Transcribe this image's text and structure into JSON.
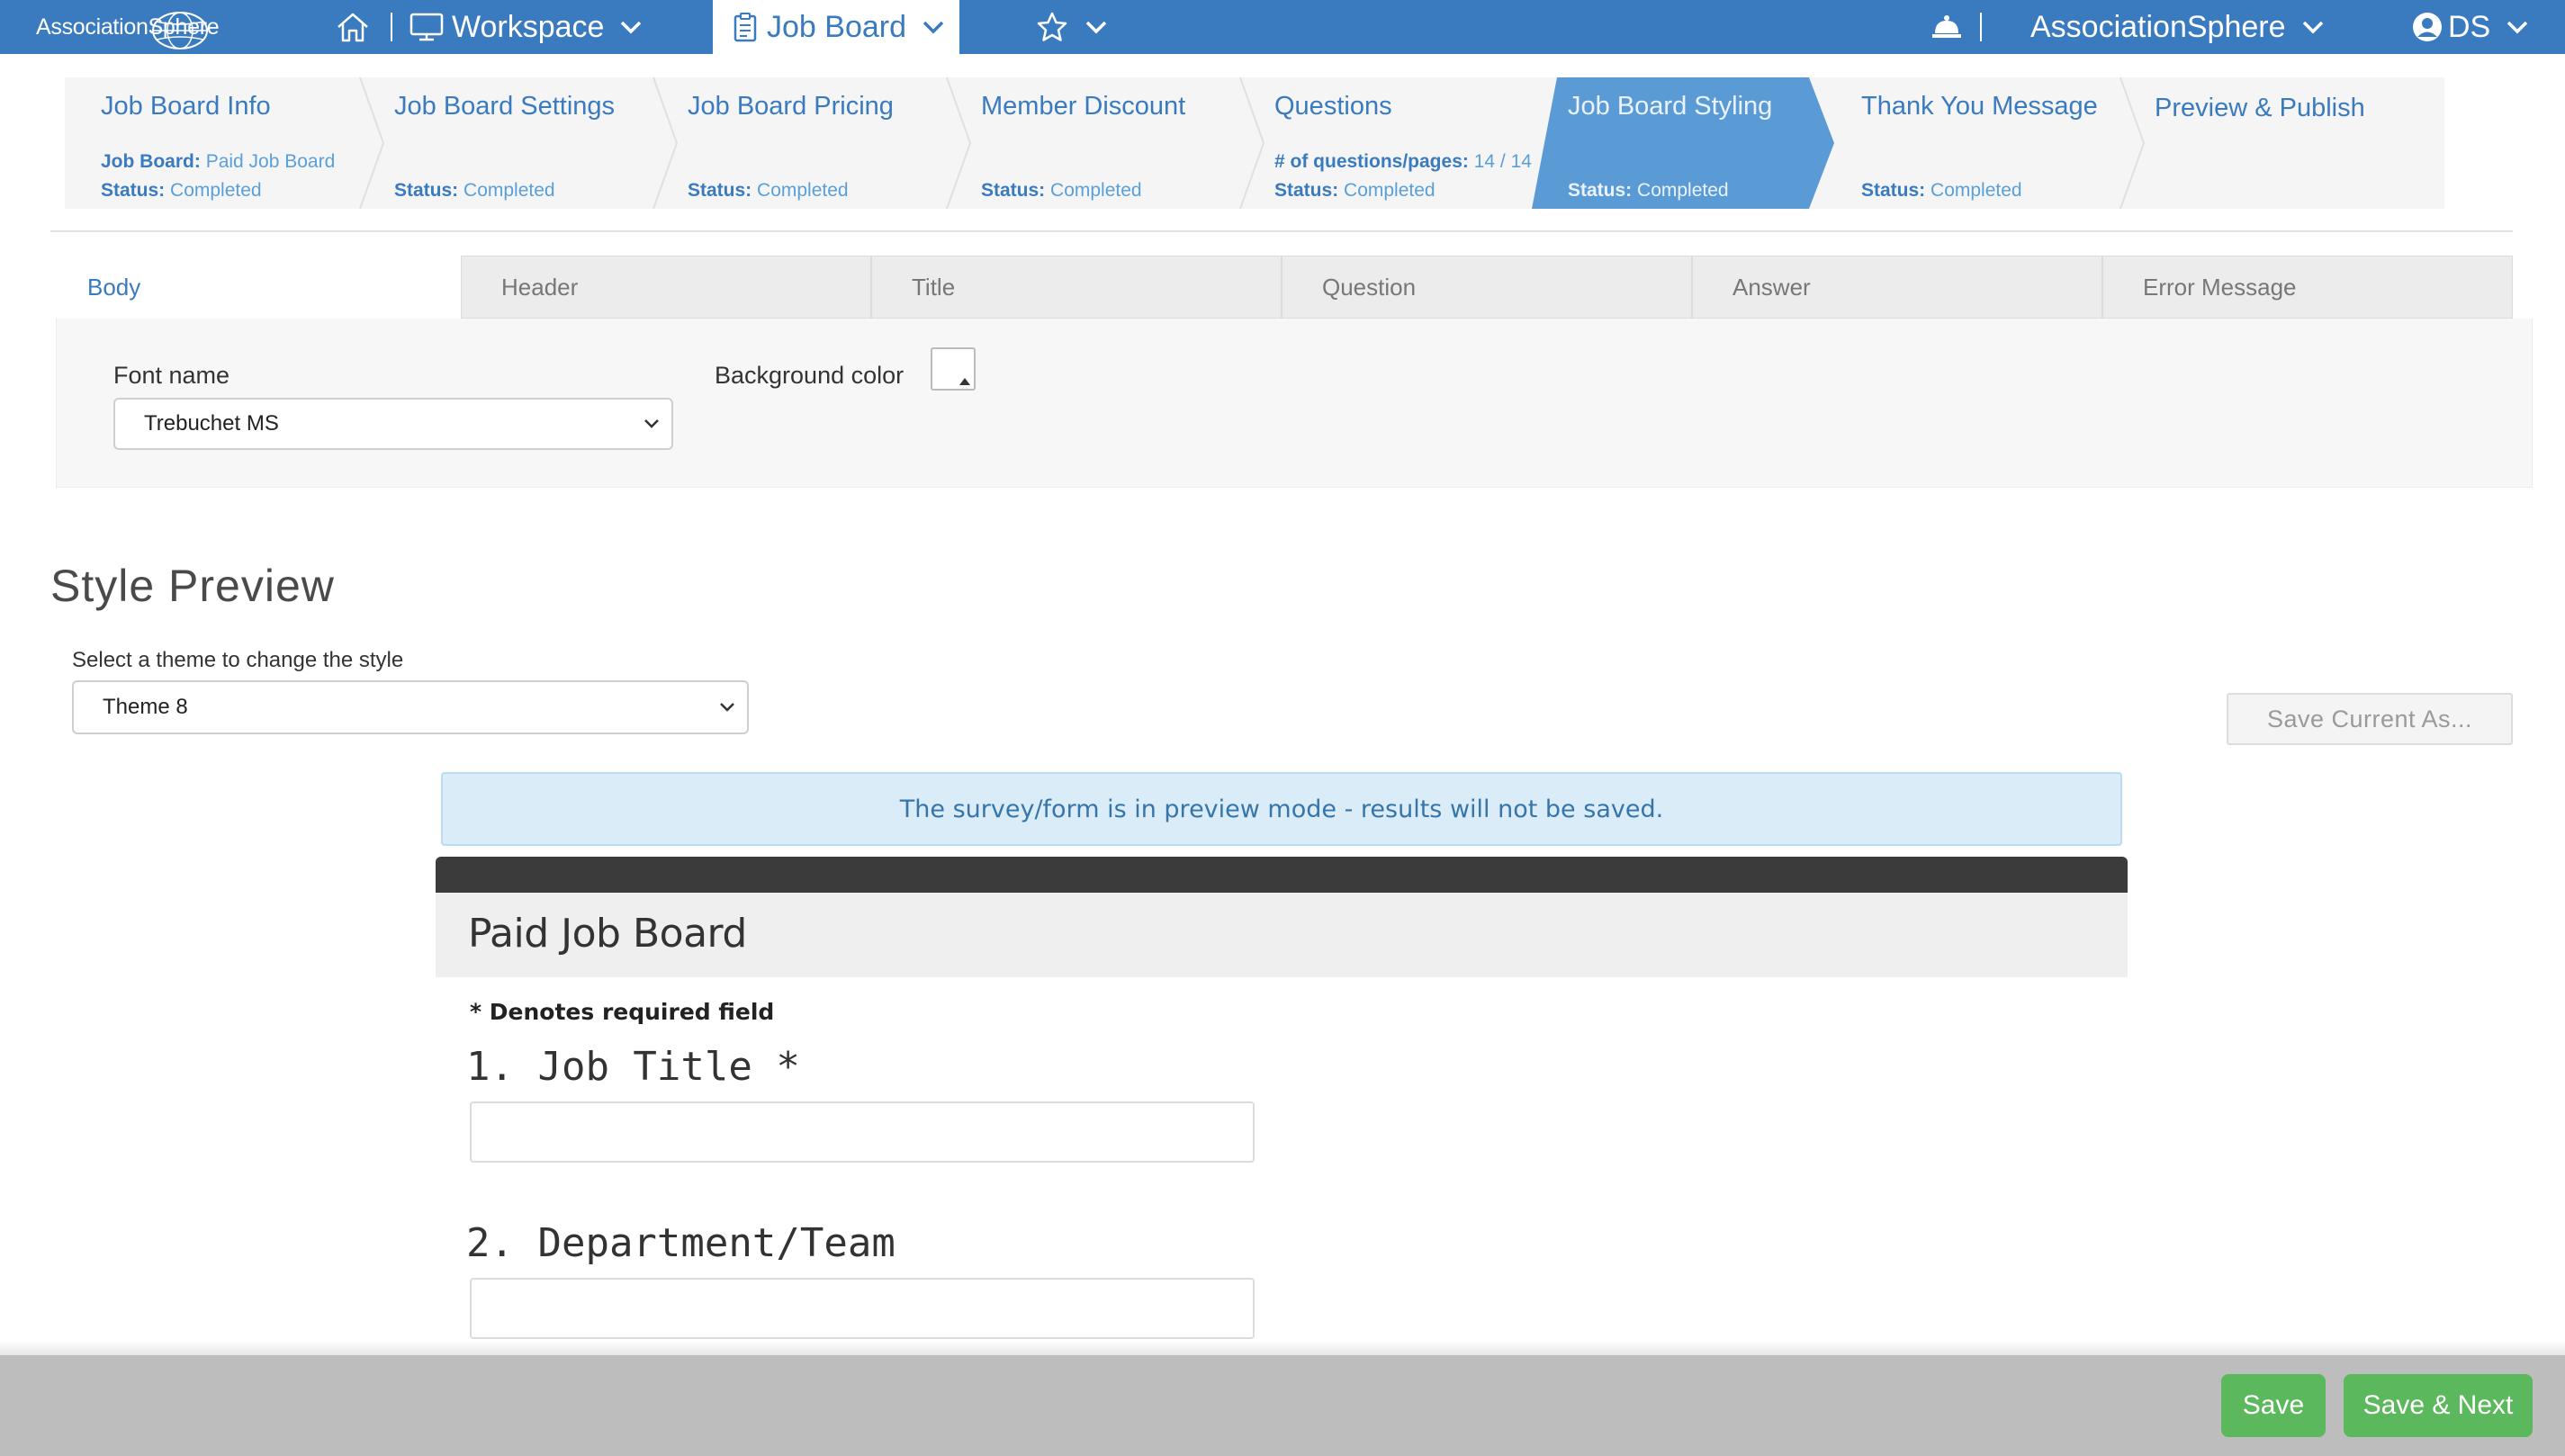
{
  "topnav": {
    "logo_text": "AssociationSphere",
    "workspace_label": "Workspace",
    "active_module_label": "Job Board",
    "org_label": "AssociationSphere",
    "user_initials": "DS"
  },
  "steps": [
    {
      "title": "Job Board Info",
      "line1_label": "Job Board:",
      "line1_value": "Paid Job Board",
      "status_label": "Status:",
      "status_value": "Completed"
    },
    {
      "title": "Job Board Settings",
      "status_label": "Status:",
      "status_value": "Completed"
    },
    {
      "title": "Job Board Pricing",
      "status_label": "Status:",
      "status_value": "Completed"
    },
    {
      "title": "Member Discount",
      "status_label": "Status:",
      "status_value": "Completed"
    },
    {
      "title": "Questions",
      "line1_label": "# of questions/pages:",
      "line1_value": "14 / 14",
      "status_label": "Status:",
      "status_value": "Completed"
    },
    {
      "title": "Job Board Styling",
      "status_label": "Status:",
      "status_value": "Completed",
      "active": true
    },
    {
      "title": "Thank You Message",
      "status_label": "Status:",
      "status_value": "Completed"
    },
    {
      "title": "Preview & Publish"
    }
  ],
  "style_tabs": [
    "Body",
    "Header",
    "Title",
    "Question",
    "Answer",
    "Error Message"
  ],
  "body_panel": {
    "font_name_label": "Font name",
    "font_name_value": "Trebuchet MS",
    "background_color_label": "Background color",
    "background_color_value": "#ffffff"
  },
  "preview": {
    "heading": "Style Preview",
    "theme_label": "Select a theme to change the style",
    "theme_value": "Theme 8",
    "save_as_label": "Save Current As...",
    "alert_text": "The survey/form is in preview mode - results will not be saved.",
    "form_title": "Paid Job Board",
    "required_note": "* Denotes required field",
    "questions": [
      {
        "label": "1. Job Title *"
      },
      {
        "label": "2. Department/Team"
      }
    ]
  },
  "footer": {
    "save_label": "Save",
    "save_next_label": "Save & Next"
  },
  "colors": {
    "nav_blue": "#3a7bbf",
    "active_step": "#5b9bd5",
    "button_green": "#5cb85c"
  }
}
